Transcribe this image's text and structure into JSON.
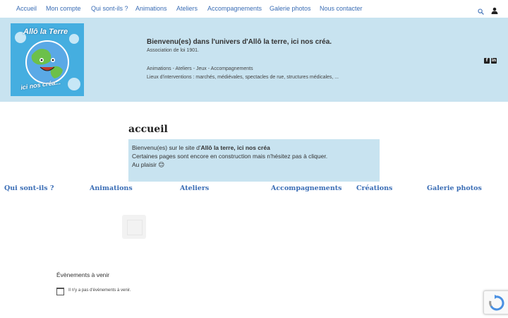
{
  "nav": {
    "items": [
      "Accueil",
      "Mon compte",
      "Qui sont-ils ?",
      "Animations",
      "Ateliers",
      "Accompagnements",
      "Galerie photos",
      "Nous contacter"
    ],
    "search_icon": "search-icon",
    "user_icon": "user-icon"
  },
  "banner": {
    "logo_text_top": "Allô la Terre",
    "logo_text_bottom": "ici nos créa...",
    "title": "Bienvenu(es) dans l'univers d'Allô la terre, ici nos créa.",
    "subtitle": "Association de loi 1901.",
    "activities": "Animations - Ateliers - Jeux - Accompagnements",
    "locations": "Lieux d'interventions : marchés, médiévales, spectacles de rue, structures médicales, ...",
    "social": [
      "facebook-icon",
      "linkedin-icon"
    ]
  },
  "main": {
    "page_title": "accueil",
    "welcome_prefix": "Bienvenu(es) sur le site d'",
    "welcome_name": "Allô la terre, ici nos créa",
    "welcome_line2": "Certaines pages sont encore en construction mais n'hésitez pas à cliquer.",
    "welcome_line3": "Au plaisir 😊",
    "categories": [
      "Qui sont-ils ?",
      "Animations",
      "Ateliers",
      "Accompagnements",
      "Créations",
      "Galerie photos"
    ]
  },
  "events": {
    "title": "Évènements à venir",
    "empty": "Il n'y a pas d'évènements à venir."
  },
  "colors": {
    "link": "#3a6db5",
    "banner_bg": "#c8e3f0"
  }
}
